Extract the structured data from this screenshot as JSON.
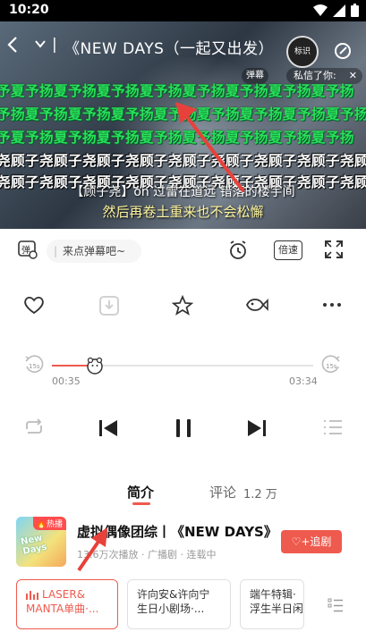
{
  "status_bar": {
    "time": "10:20"
  },
  "video": {
    "title": "《NEW DAYS（一起又出发）",
    "avatar_text": "标识",
    "danmaku_button": "弹幕",
    "private_msg": "私信了你:",
    "danmaku_green": [
      "予夏予扬夏予扬夏予扬夏予扬夏予扬夏予扬夏予扬夏予扬",
      "予扬夏予扬夏予扬夏予扬夏予扬夏予扬夏予扬夏予扬夏予扬",
      "予夏予扬夏予扬夏予扬夏予扬夏予扬夏予扬夏予扬夏予扬"
    ],
    "danmaku_white": [
      "尧顾子尧顾子尧顾子尧顾子尧顾子尧顾子尧顾子尧顾子尧顾",
      "尧顾子尧顾子尧顾子尧顾子尧顾子尧顾子尧顾子尧顾子尧顾"
    ],
    "subtitle_1": "【顾子尧】on 过雷在道远 错落的楼宇间",
    "subtitle_2": "然后再卷土重来也不会松懈"
  },
  "controls": {
    "danmaku_icon_label": "弹",
    "danmaku_placeholder": "来点弹幕吧~",
    "speed_label": "倍速"
  },
  "progress": {
    "current": "00:35",
    "total": "03:34",
    "fraction": 0.163,
    "skip_back": "15s",
    "skip_forward": "15s"
  },
  "tabs": {
    "intro": "简介",
    "comment": "评论",
    "comment_count": "1.2 万"
  },
  "show": {
    "cover_badge": "热播",
    "cover_text": "New Days",
    "title": "虚拟偶像团综丨《NEW DAYS》",
    "meta": "13.6万次播放 · 广播剧 · 连载中",
    "follow_label": "追剧"
  },
  "episodes": [
    {
      "line1": "LASER&",
      "line2": "MANTA单曲·..."
    },
    {
      "line1": "许向安&许向宁",
      "line2": "生日小剧场·..."
    },
    {
      "line1": "端午特辑·",
      "line2": "浮生半日闲"
    }
  ],
  "colors": {
    "accent": "#ef5a4e",
    "danmaku_green": "#28e05a"
  }
}
